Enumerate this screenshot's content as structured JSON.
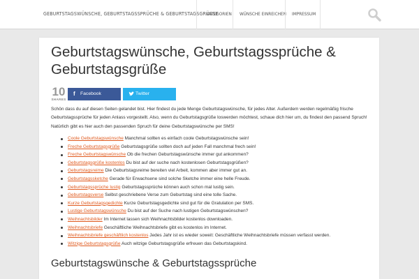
{
  "header": {
    "site_title": "Geburtstagswünsche, Geburtstagssprüche & Geburtstagsgrüße",
    "nav": [
      {
        "label": "Kategorien"
      },
      {
        "label": "Wünsche einreichen"
      },
      {
        "label": "Impressum"
      }
    ],
    "search_icon": "search-icon"
  },
  "article": {
    "title": "Geburtstagswünsche, Geburtstagssprüche & Geburtstagsgrüße",
    "share": {
      "count": "10",
      "count_label": "SHARES",
      "facebook_label": "Facebook",
      "twitter_label": "Twitter",
      "facebook_color": "#3b5998",
      "twitter_color": "#29b1ee"
    },
    "intro": "Schön dass du auf diesen Seiten gelandet bist. Hier findest du jede Menge Geburtstagswünsche, für jedes Alter. Außerdem werden regelmäßig frische Geburtstagssprüche für jeden Anlass vorgestellt. Also, wenn du Geburtstagsgrüße loswerden möchtest, schaue dich hier um, du findest den passend Spruch! Natürlich gibt es hier auch den passenden Spruch für deine Geburtstagswünsche per SMS!",
    "link_color": "#e05a1e",
    "links": [
      {
        "link": "Coole Geburtstagswünsche",
        "text": " Manchmal sollten es einfach coole Geburtstagswünsche sein!"
      },
      {
        "link": "Freche Geburtstagsgrüße",
        "text": " Geburtstagsgrüße sollten doch auf jeden Fall manchmal frech sein!"
      },
      {
        "link": "Freche Geburtstagswünsche",
        "text": " Ob die frechen Geburtstagswünsche immer gut ankommen?"
      },
      {
        "link": "Geburtstagsgrüße kostenlos",
        "text": " Du bist auf der suche nach kostenlosen Geburtstagsgrüßen?"
      },
      {
        "link": "Geburtstagsreime",
        "text": " Die Geburtstagsreime bereiten viel Arbeit, kommen aber immer gut an."
      },
      {
        "link": "Geburtstagssketche",
        "text": " Gerade für Erwachsene sind solche Sketche immer eine helle Freude."
      },
      {
        "link": "Geburtstagssprüche lustig",
        "text": " Geburtstagssprüche können auch schon mal lustig sein."
      },
      {
        "link": "Geburtstagsverse",
        "text": " Selbst geschriebene Verse zum Geburtstag sind eine tolle Sache."
      },
      {
        "link": "Kurze Geburtstagsgedichte",
        "text": " Kurze Geburtstagsgedichte sind gut für die Gratulation per SMS."
      },
      {
        "link": "Lustige Geburtstagswünsche",
        "text": " Du bist auf der Suche nach lustigen Geburtstagswünschen?"
      },
      {
        "link": "Weihnachtsbilder",
        "text": " Im Internet lassen sich Weihnachtsbilder kostenlos downloaden."
      },
      {
        "link": "Weihnachtsbriefe",
        "text": " Geschäftliche Weihnachtsbriefe gibt es kostenlos im Internet."
      },
      {
        "link": "Weihnachtsbriefe geschäftlich kostenlos",
        "text": " Jedes Jahr ist es wieder soweit: Geschäftliche Weihnachtsbriefe müssen verfasst werden."
      },
      {
        "link": "Witzige Geburtstagsgrüße",
        "text": " Auch witzige Geburtstagsgrüße erfreuen das Geburtstagskind."
      }
    ],
    "subheading": "Geburtstagswünsche & Geburtstagssprüche"
  }
}
